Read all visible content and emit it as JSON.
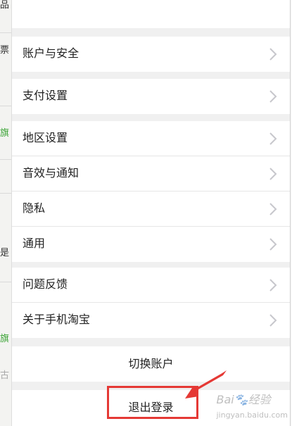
{
  "settings": {
    "account_security": "账户与安全",
    "payment_settings": "支付设置",
    "region_settings": "地区设置",
    "sound_notifications": "音效与通知",
    "privacy": "隐私",
    "general": "通用",
    "feedback": "问题反馈",
    "about_app": "关于手机淘宝",
    "switch_account": "切换账户",
    "logout": "退出登录"
  },
  "background_fragments": [
    "品",
    "票",
    "旗",
    "是",
    "旗",
    "古"
  ],
  "watermark": {
    "brand": "Bai",
    "suffix": "经验",
    "site": "jingyan.baidu.com"
  },
  "colors": {
    "annotation": "#e53935",
    "panel_bg": "#f0f0f0",
    "row_bg": "#ffffff",
    "chevron": "#c7c7cc"
  },
  "icons": {
    "chevron": "chevron-right-icon",
    "arrow": "red-arrow-annotation"
  }
}
